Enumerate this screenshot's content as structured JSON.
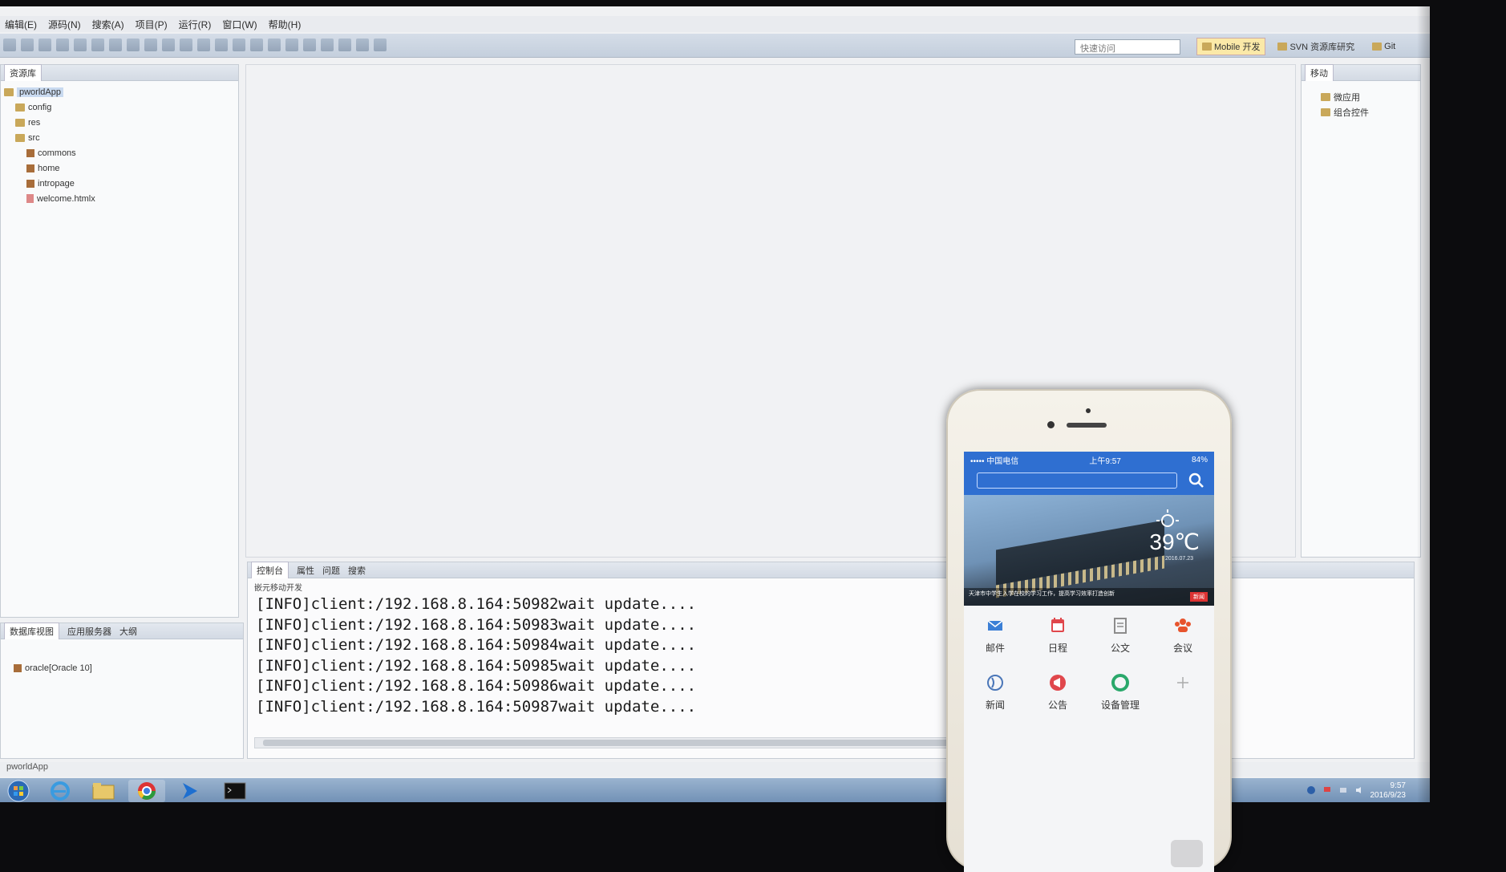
{
  "menubar": [
    "编辑(E)",
    "源码(N)",
    "搜索(A)",
    "项目(P)",
    "运行(R)",
    "窗口(W)",
    "帮助(H)"
  ],
  "toolbar": {
    "quick_access_placeholder": "快速访问"
  },
  "perspectives": [
    {
      "label": "Mobile 开发",
      "active": true
    },
    {
      "label": "SVN 资源库研究",
      "active": false
    },
    {
      "label": "Git",
      "active": false
    }
  ],
  "explorer": {
    "tab": "资源库",
    "tree": [
      {
        "label": "pworldApp",
        "indent": 0,
        "icon": "project-icon",
        "selected": true
      },
      {
        "label": "config",
        "indent": 1,
        "icon": "folder-icon"
      },
      {
        "label": "res",
        "indent": 1,
        "icon": "folder-icon"
      },
      {
        "label": "src",
        "indent": 1,
        "icon": "folder-icon"
      },
      {
        "label": "commons",
        "indent": 2,
        "icon": "package-icon"
      },
      {
        "label": "home",
        "indent": 2,
        "icon": "package-icon"
      },
      {
        "label": "intropage",
        "indent": 2,
        "icon": "package-icon"
      },
      {
        "label": "welcome.htmlx",
        "indent": 2,
        "icon": "file-icon"
      }
    ]
  },
  "outline": {
    "tab": "移动",
    "items": [
      "微应用",
      "组合控件"
    ]
  },
  "dbpane": {
    "tabs": [
      "数据库视图",
      "应用服务器",
      "大纲"
    ],
    "items": [
      "oracle[Oracle 10]"
    ]
  },
  "console": {
    "tabs": [
      "控制台",
      "属性",
      "问题",
      "搜索"
    ],
    "subtitle": "嵌元移动开发",
    "lines": [
      "[INFO]client:/192.168.8.164:50982wait update....",
      "[INFO]client:/192.168.8.164:50983wait update....",
      "[INFO]client:/192.168.8.164:50984wait update....",
      "[INFO]client:/192.168.8.164:50985wait update....",
      "[INFO]client:/192.168.8.164:50986wait update....",
      "[INFO]client:/192.168.8.164:50987wait update...."
    ]
  },
  "status_line": "pworldApp",
  "taskbar": {
    "clock_time": "9:57",
    "clock_date": "2016/9/23"
  },
  "phone": {
    "carrier": "••••• 中国电信",
    "time": "上午9:57",
    "battery": "84%",
    "weather": {
      "temp": "39℃",
      "date": "2016.07.23"
    },
    "banner_caption": "天津市中学生入学在校的学习工作，提高学习效率打造创新",
    "banner_tag": "新闻",
    "apps": [
      {
        "label": "邮件",
        "icon": "mail-icon",
        "color": "#3b7fd6"
      },
      {
        "label": "日程",
        "icon": "calendar-icon",
        "color": "#e0474c"
      },
      {
        "label": "公文",
        "icon": "document-icon",
        "color": "#8c8c8c"
      },
      {
        "label": "会议",
        "icon": "meeting-icon",
        "color": "#e7542d"
      },
      {
        "label": "新闻",
        "icon": "globe-icon",
        "color": "#4a76b8"
      },
      {
        "label": "公告",
        "icon": "megaphone-icon",
        "color": "#e0474c"
      },
      {
        "label": "设备管理",
        "icon": "device-icon",
        "color": "#2aa86b"
      },
      {
        "label": "",
        "icon": "add-icon",
        "color": "#aaaaaa"
      }
    ]
  }
}
